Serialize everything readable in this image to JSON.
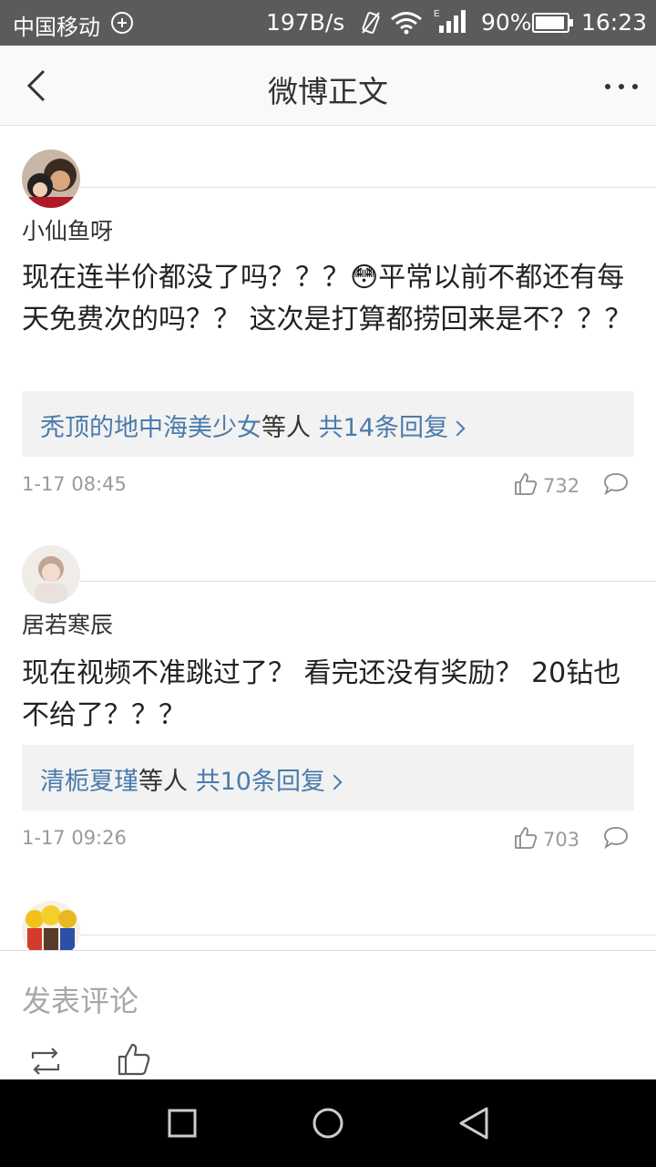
{
  "status_bar": {
    "carrier": "中国移动",
    "speed": "197B/s",
    "network_type": "E",
    "battery": "90%",
    "time": "16:23"
  },
  "header": {
    "title": "微博正文"
  },
  "comments": [
    {
      "username": "小仙鱼呀",
      "text": "现在连半价都没了吗？？？😳平常以前不都还有每天免费次的吗？？ 这次是打算都捞回来是不？？？",
      "reply_users": "秃顶的地中海美少女",
      "reply_others": "等人",
      "reply_count": "共14条回复",
      "time": "1-17 08:45",
      "likes": "732"
    },
    {
      "username": "居若寒辰",
      "text": "现在视频不准跳过了？ 看完还没有奖励？ 20钻也不给了？？？",
      "reply_users": "清栀夏瑾",
      "reply_others": "等人",
      "reply_count": "共10条回复",
      "time": "1-17 09:26",
      "likes": "703"
    }
  ],
  "compose": {
    "placeholder": "发表评论"
  },
  "colors": {
    "link": "#4a7bab",
    "status_bar": "#5b5b5b",
    "meta_text": "#9a9a9a"
  },
  "icons": [
    "back-icon",
    "more-icon",
    "like-icon",
    "comment-icon",
    "repost-icon",
    "square-nav-icon",
    "circle-nav-icon",
    "triangle-nav-icon"
  ]
}
